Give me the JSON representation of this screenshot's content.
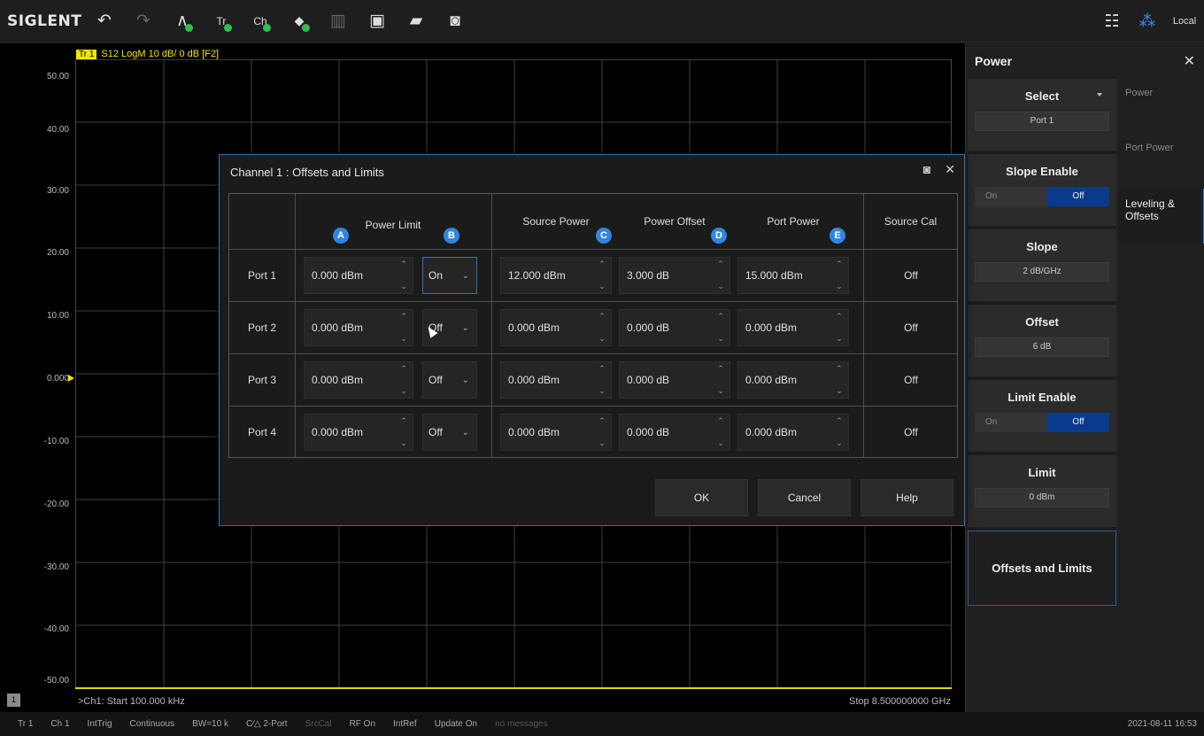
{
  "toolbar": {
    "brand": "SIGLENT",
    "tools": [
      {
        "icon": "undo-icon",
        "glyph": "↶"
      },
      {
        "icon": "redo-icon",
        "glyph": "↷"
      },
      {
        "icon": "add-trace-icon",
        "glyph": "∧"
      },
      {
        "icon": "trace-window-icon",
        "glyph": "Tr"
      },
      {
        "icon": "channel-window-icon",
        "glyph": "Ch"
      },
      {
        "icon": "add-marker-icon",
        "glyph": "◆"
      },
      {
        "icon": "delete-icon",
        "glyph": "▥"
      },
      {
        "icon": "save-icon",
        "glyph": "▣"
      },
      {
        "icon": "open-icon",
        "glyph": "▰"
      },
      {
        "icon": "camera-icon",
        "glyph": "◙"
      }
    ],
    "local_label": "Local"
  },
  "plot": {
    "trace_tag": "Tr 1",
    "trace_desc": "S12 LogM 10 dB/ 0 dB [F2]",
    "y_labels": [
      "50.00",
      "40.00",
      "30.00",
      "20.00",
      "10.00",
      "0.000",
      "-10.00",
      "-20.00",
      "-30.00",
      "-40.00",
      "-50.00"
    ],
    "start": ">Ch1: Start 100.000 kHz",
    "stop": "Stop 8.500000000 GHz",
    "channel_box": "1"
  },
  "status": {
    "items": [
      "Tr 1",
      "Ch 1",
      "IntTrig",
      "Continuous",
      "BW=10 k",
      "C⁄△ 2-Port",
      "SrcCal",
      "RF On",
      "IntRef",
      "Update On",
      "no messages"
    ],
    "date": "2021-08-11 16:53"
  },
  "side": {
    "title": "Power",
    "select_label": "Select",
    "select_value": "Port 1",
    "slope_enable_label": "Slope Enable",
    "on": "On",
    "off": "Off",
    "slope_label": "Slope",
    "slope_value": "2 dB/GHz",
    "offset_label": "Offset",
    "offset_value": "6 dB",
    "limit_enable_label": "Limit Enable",
    "limit_label": "Limit",
    "limit_value": "0 dBm",
    "offsets_limits_label": "Offsets and Limits",
    "tabs": [
      "Power",
      "Port Power",
      "Leveling & Offsets"
    ]
  },
  "dialog": {
    "title": "Channel 1 : Offsets and Limits",
    "headers": {
      "power_limit": "Power Limit",
      "source_power": "Source Power",
      "power_offset": "Power Offset",
      "port_power": "Port Power",
      "source_cal": "Source Cal"
    },
    "badges": [
      "A",
      "B",
      "C",
      "D",
      "E"
    ],
    "rows": [
      {
        "port": "Port 1",
        "limit": "0.000 dBm",
        "enable": "On",
        "source": "12.000 dBm",
        "offset": "3.000 dB",
        "port_power": "15.000 dBm",
        "cal": "Off"
      },
      {
        "port": "Port 2",
        "limit": "0.000 dBm",
        "enable": "Off",
        "source": "0.000 dBm",
        "offset": "0.000 dB",
        "port_power": "0.000 dBm",
        "cal": "Off"
      },
      {
        "port": "Port 3",
        "limit": "0.000 dBm",
        "enable": "Off",
        "source": "0.000 dBm",
        "offset": "0.000 dB",
        "port_power": "0.000 dBm",
        "cal": "Off"
      },
      {
        "port": "Port 4",
        "limit": "0.000 dBm",
        "enable": "Off",
        "source": "0.000 dBm",
        "offset": "0.000 dB",
        "port_power": "0.000 dBm",
        "cal": "Off"
      }
    ],
    "ok": "OK",
    "cancel": "Cancel",
    "help": "Help"
  }
}
